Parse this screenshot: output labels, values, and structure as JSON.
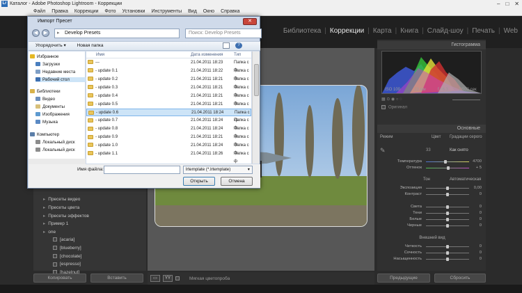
{
  "app": {
    "title": "Каталог - Adobe Photoshop Lightroom - Коррекции",
    "window_controls": [
      "–",
      "□",
      "✕"
    ]
  },
  "menu": [
    "Файл",
    "Правка",
    "Коррекции",
    "Фото",
    "Установки",
    "Инструменты",
    "Вид",
    "Окно",
    "Справка"
  ],
  "modules": [
    {
      "label": "Библиотека",
      "active": false
    },
    {
      "label": "Коррекции",
      "active": true
    },
    {
      "label": "Карта",
      "active": false
    },
    {
      "label": "Книга",
      "active": false
    },
    {
      "label": "Слайд-шоу",
      "active": false
    },
    {
      "label": "Печать",
      "active": false
    },
    {
      "label": "Web",
      "active": false
    }
  ],
  "left_panel": {
    "folders": [
      "Пресеты видео",
      "Пресеты цвета",
      "Пресеты эффектов",
      "Пример 1",
      "one"
    ],
    "presets": [
      "[acaria]",
      "[blueberry]",
      "[chocolate]",
      "[espresso]",
      "[hazelnut]"
    ],
    "copy_button": "Копировать",
    "paste_button": "Вставить"
  },
  "bottom_bar": {
    "soft_proof": "Мягкая цветопроба"
  },
  "right_panel": {
    "histogram_title": "Гистограмма",
    "exif": [
      "ISO 100",
      "23 мм",
      "f / 6.3",
      "1/500 сек"
    ],
    "original_label": "Оригинал",
    "basic_title": "Основные",
    "mode_label": "Режим",
    "mode_color": "Цвет",
    "mode_bw": "Градации серого",
    "wb_value": "Как снято",
    "tone_label": "Тон",
    "auto_label": "Автоматическая",
    "presence_label": "Внешний вид",
    "sliders": [
      {
        "label": "Температура",
        "value": "4700",
        "pos": 0.45
      },
      {
        "label": "Оттенок",
        "value": "+ 5",
        "pos": 0.52
      },
      {
        "label": "Экспозиция",
        "value": "0,00",
        "pos": 0.5
      },
      {
        "label": "Контраст",
        "value": "0",
        "pos": 0.5
      },
      {
        "label": "Света",
        "value": "0",
        "pos": 0.5
      },
      {
        "label": "Тени",
        "value": "0",
        "pos": 0.5
      },
      {
        "label": "Белые",
        "value": "0",
        "pos": 0.5
      },
      {
        "label": "Черные",
        "value": "0",
        "pos": 0.5
      },
      {
        "label": "Четкость",
        "value": "0",
        "pos": 0.5
      },
      {
        "label": "Сочность",
        "value": "0",
        "pos": 0.5
      },
      {
        "label": "Насыщенность",
        "value": "0",
        "pos": 0.5
      }
    ],
    "previous_button": "Предыдущие",
    "reset_button": "Сбросить"
  },
  "dialog": {
    "title": "Импорт Пресет",
    "path": "Develop Presets",
    "search_placeholder": "Поиск: Develop Presets",
    "organize": "Упорядочить ▾",
    "new_folder": "Новая папка",
    "nav": [
      {
        "label": "Избранное",
        "icon": "star-icon",
        "color": "#e5b824"
      },
      {
        "label": "Загрузки",
        "icon": "download-icon",
        "color": "#4a7fbf"
      },
      {
        "label": "Недавние места",
        "icon": "recent-icon",
        "color": "#7f9fc6"
      },
      {
        "label": "Рабочий стол",
        "icon": "desktop-icon",
        "color": "#3d6fb0"
      },
      {
        "label": "Библиотеки",
        "icon": "library-icon",
        "color": "#d8b24a"
      },
      {
        "label": "Видео",
        "icon": "video-icon",
        "color": "#6a8fbe"
      },
      {
        "label": "Документы",
        "icon": "document-icon",
        "color": "#d8c07a"
      },
      {
        "label": "Изображения",
        "icon": "image-icon",
        "color": "#5e9ad0"
      },
      {
        "label": "Музыка",
        "icon": "music-icon",
        "color": "#5b8ac4"
      },
      {
        "label": "Компьютер",
        "icon": "computer-icon",
        "color": "#5b7ea8"
      },
      {
        "label": "Локальный диск",
        "icon": "drive-icon",
        "color": "#8c8c8c"
      },
      {
        "label": "Локальный диск",
        "icon": "drive-icon",
        "color": "#8c8c8c"
      }
    ],
    "columns": [
      "Имя",
      "Дата изменения",
      "Тип"
    ],
    "files": [
      {
        "name": "---",
        "date": "21.04.2011 18:23",
        "type": "Папка с ф"
      },
      {
        "name": "- update 0.1",
        "date": "21.04.2011 18:22",
        "type": "Папка с ф"
      },
      {
        "name": "- update 0.2",
        "date": "21.04.2011 18:21",
        "type": "Папка с ф"
      },
      {
        "name": "- update 0.3",
        "date": "21.04.2011 18:21",
        "type": "Папка с ф"
      },
      {
        "name": "- update 0.4",
        "date": "21.04.2011 18:21",
        "type": "Папка с ф"
      },
      {
        "name": "- update 0.5",
        "date": "21.04.2011 18:21",
        "type": "Папка с ф"
      },
      {
        "name": "- update 0.6",
        "date": "21.04.2011 18:24",
        "type": "Папка с ф"
      },
      {
        "name": "- update 0.7",
        "date": "21.04.2011 18:24",
        "type": "Папка с ф"
      },
      {
        "name": "- update 0.8",
        "date": "21.04.2011 18:24",
        "type": "Папка с ф"
      },
      {
        "name": "- update 0.9",
        "date": "21.04.2011 18:21",
        "type": "Папка с ф"
      },
      {
        "name": "- update 1.0",
        "date": "21.04.2011 18:24",
        "type": "Папка с ф"
      },
      {
        "name": "- update 1.1",
        "date": "21.04.2011 18:26",
        "type": "Папка с ф"
      }
    ],
    "selected_index": 6,
    "filename_label": "Имя файла:",
    "filename_value": "",
    "filetype": "lrtemplate (*.lrtemplate)",
    "open_button": "Открыть",
    "cancel_button": "Отмена"
  }
}
